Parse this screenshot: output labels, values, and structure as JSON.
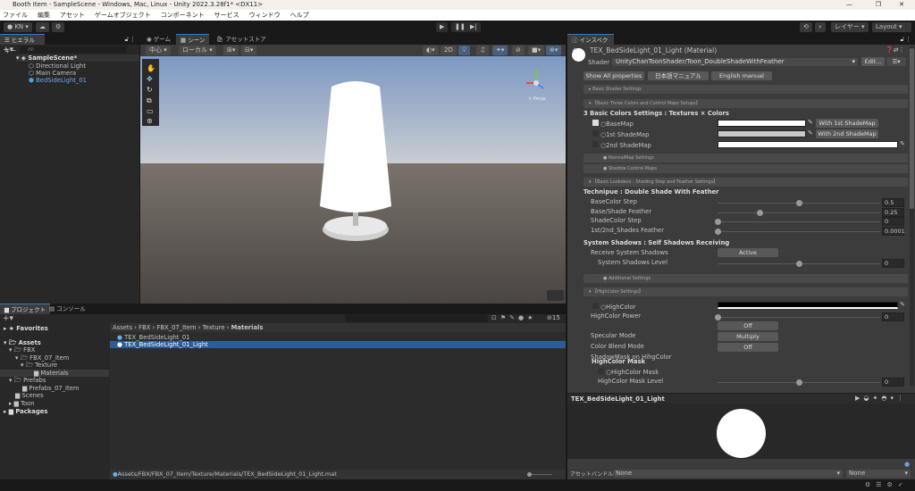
{
  "window": {
    "title": "Booth Item - SampleScene - Windows, Mac, Linux - Unity 2022.3.28f1* <DX11>",
    "controls": [
      "—",
      "❐",
      "✕"
    ]
  },
  "menu": [
    "ファイル",
    "編集",
    "アセット",
    "ゲームオブジェクト",
    "コンポーネント",
    "サービス",
    "ウィンドウ",
    "ヘルプ"
  ],
  "toolbar": {
    "account": "KN",
    "layers": "レイヤー",
    "layout": "Layout"
  },
  "hierarchy": {
    "tab": "ヒエラルキー",
    "search_placeholder": "All",
    "scene": "SampleScene*",
    "items": [
      "Directional Light",
      "Main Camera",
      "BedSideLight_01"
    ]
  },
  "scene_view": {
    "tabs": [
      "ゲーム",
      "シーン",
      "アセットストア"
    ],
    "pivot": "中心",
    "space": "ローカル",
    "mode_2d": "2D",
    "gizmo_label": "< Persp"
  },
  "inspector": {
    "tab": "インスペクター",
    "title": "TEX_BedSideLight_01_Light (Material)",
    "shader_label": "Shader",
    "shader": "UnityChanToonShader/Toon_DoubleShadeWithFeather",
    "edit": "Edit...",
    "buttons": [
      "Show All properties",
      "日本語マニュアル",
      "English manual"
    ],
    "sections": {
      "basic_shader": "Basic Shader Settings",
      "three_colors": "【Basic Three Colors and Control Maps Setups】",
      "normal": "● NormalMap Settings",
      "shadow_maps": "● Shadow Control Maps",
      "lookdevs": "【Basic Lookdevs : Shading Step and Feather Settings】",
      "additional": "● Additional Settings",
      "highcolor": "【HighColor Settings】"
    },
    "colors_heading": "3 Basic Colors Settings : Textures × Colors",
    "maps": [
      {
        "label": "BaseMap",
        "color": "#ffffff",
        "button": "With 1st ShadeMap"
      },
      {
        "label": "1st ShadeMap",
        "color": "#c8c8c8",
        "button": "With 2nd ShadeMap"
      },
      {
        "label": "2nd ShadeMap",
        "color": "#ffffff"
      }
    ],
    "technique_heading": "Technipue : Double Shade With Feather",
    "sliders": [
      {
        "label": "BaseColor Step",
        "value": "0.5",
        "level": 0.5
      },
      {
        "label": "Base/Shade Feather",
        "value": "0.25",
        "level": 0.26
      },
      {
        "label": "ShadeColor Step",
        "value": "0",
        "level": 0
      },
      {
        "label": "1st/2nd_Shades Feather",
        "value": "0.0001",
        "level": 0
      }
    ],
    "system_heading": "System Shadows : Self Shadows Receiving",
    "receive_label": "Receive System Shadows",
    "receive_value": "Active",
    "shadow_level": {
      "label": "System Shadows Level",
      "value": "0",
      "level": 0.5
    },
    "highcolor": {
      "label": "HighColor",
      "color": "#000000"
    },
    "highcolor_power": {
      "label": "HighColor Power",
      "value": "0",
      "level": 0
    },
    "toggles": [
      {
        "label": "Specular Mode",
        "value": "Off"
      },
      {
        "label": "Color Blend Mode",
        "value": "Multiply"
      },
      {
        "label": "ShadowMask on HihgColor",
        "value": "Off"
      }
    ],
    "mask_heading": "HighColor Mask",
    "mask_label": "HighColor Mask",
    "mask_level": {
      "label": "HighColor Mask Level",
      "value": "0",
      "level": 0.5
    },
    "preview_title": "TEX_BedSideLight_01_Light",
    "assetbundle_label": "アセットバンドル",
    "assetbundle": "None",
    "variant": "None"
  },
  "project": {
    "tabs": [
      "プロジェクト",
      "コンソール"
    ],
    "hidden_count": "15",
    "tree": [
      "Favorites",
      "Assets",
      "FBX",
      "FBX_07_Item",
      "Texture",
      "Materials",
      "Prefabs",
      "Prefabs_07_Item",
      "Scenes",
      "Toon",
      "Packages"
    ],
    "breadcrumb": [
      "Assets",
      "FBX",
      "FBX_07_Item",
      "Texture",
      "Materials"
    ],
    "files": [
      "TEX_BedSideLight_01",
      "TEX_BedSideLight_01_Light"
    ],
    "path": "Assets/FBX/FBX_07_Item/Texture/Materials/TEX_BedSideLight_01_Light.mat"
  }
}
